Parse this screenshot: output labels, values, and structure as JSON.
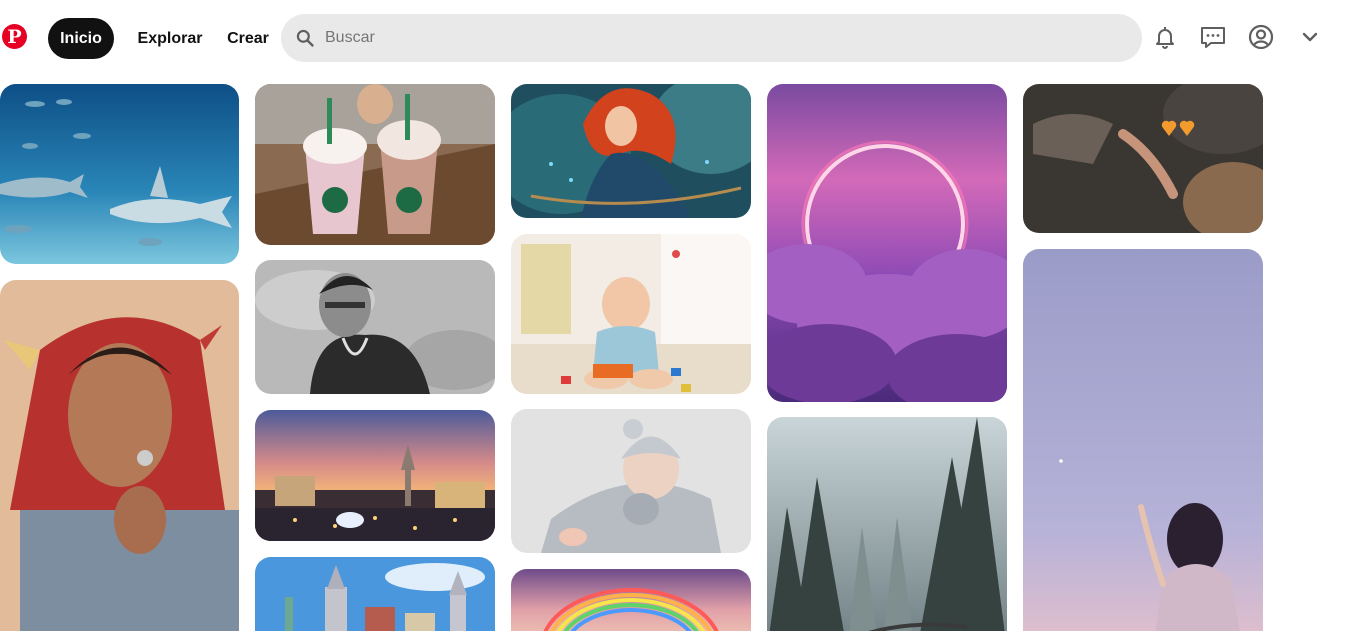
{
  "header": {
    "logo_letter": "P",
    "nav": {
      "home": "Inicio",
      "explore": "Explorar",
      "create": "Crear"
    },
    "search": {
      "placeholder": "Buscar",
      "value": ""
    },
    "icons": [
      "search-icon",
      "bell-icon",
      "chat-icon",
      "profile-icon",
      "chevron-down-icon"
    ]
  },
  "colors": {
    "brand": "#e60023",
    "active_nav_bg": "#111111",
    "search_bg": "#e9e9e9"
  },
  "pins": [
    {
      "id": "shark",
      "subject": "sharks underwater"
    },
    {
      "id": "hood-man",
      "subject": "man in red devil-horn hood"
    },
    {
      "id": "starbucks",
      "subject": "two Starbucks frappuccinos"
    },
    {
      "id": "bw-man",
      "subject": "black and white portrait"
    },
    {
      "id": "las-vegas",
      "subject": "Las Vegas strip at sunset"
    },
    {
      "id": "new-york-vegas",
      "subject": "New York New York casino skyline"
    },
    {
      "id": "merida",
      "subject": "red-haired animated archer"
    },
    {
      "id": "baby-toys",
      "subject": "baby playing with toys"
    },
    {
      "id": "newborn",
      "subject": "newborn sleeping in knit hat"
    },
    {
      "id": "rainbow",
      "subject": "rainbow in clouds"
    },
    {
      "id": "neon-ring",
      "subject": "neon ring over purple clouds"
    },
    {
      "id": "forest",
      "subject": "misty pine forest"
    },
    {
      "id": "hearts-car",
      "subject": "hands in car with orange hearts"
    },
    {
      "id": "girl-sky",
      "subject": "girl under lavender sky"
    }
  ]
}
